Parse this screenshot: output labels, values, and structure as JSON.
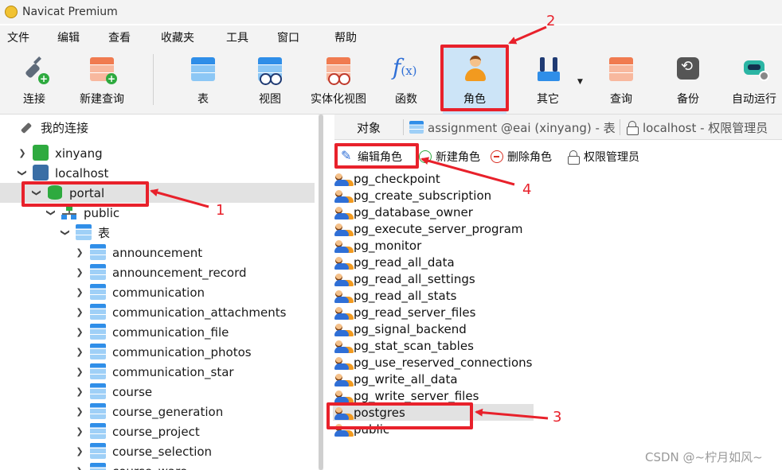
{
  "window": {
    "title": "Navicat Premium"
  },
  "menu": [
    "文件",
    "编辑",
    "查看",
    "收藏夹",
    "工具",
    "窗口",
    "帮助"
  ],
  "toolbar": {
    "connect": "连接",
    "new_query": "新建查询",
    "table": "表",
    "view": "视图",
    "materialized_view": "实体化视图",
    "function": "函数",
    "function_glyph": "f",
    "function_glyph_sub": "(x)",
    "role": "角色",
    "other": "其它",
    "query": "查询",
    "backup": "备份",
    "automation": "自动运行",
    "more_glyph": "▼"
  },
  "tree": {
    "root": "我的连接",
    "connections": [
      {
        "name": "xinyang",
        "icon": "pg-connection-green-icon"
      },
      {
        "name": "localhost",
        "icon": "pg-connection-elephant-icon"
      }
    ],
    "database": "portal",
    "schema": "public",
    "tables_folder": "表",
    "tables": [
      "announcement",
      "announcement_record",
      "communication",
      "communication_attachments",
      "communication_file",
      "communication_photos",
      "communication_star",
      "course",
      "course_generation",
      "course_project",
      "course_selection",
      "course_ware"
    ]
  },
  "tabs": {
    "objects": "对象",
    "assignment": "assignment @eai (xinyang) - 表",
    "permissions": "localhost - 权限管理员"
  },
  "object_toolbar": {
    "edit_role": "编辑角色",
    "new_role": "新建角色",
    "delete_role": "删除角色",
    "permission_manager": "权限管理员"
  },
  "roles": [
    "pg_checkpoint",
    "pg_create_subscription",
    "pg_database_owner",
    "pg_execute_server_program",
    "pg_monitor",
    "pg_read_all_data",
    "pg_read_all_settings",
    "pg_read_all_stats",
    "pg_read_server_files",
    "pg_signal_backend",
    "pg_stat_scan_tables",
    "pg_use_reserved_connections",
    "pg_write_all_data",
    "pg_write_server_files",
    "postgres",
    "public"
  ],
  "selected_role": "postgres",
  "annotations": {
    "n1": "1",
    "n2": "2",
    "n3": "3",
    "n4": "4"
  },
  "watermark": "CSDN @~柠月如风~",
  "colors": {
    "annotation": "#e8212b",
    "active_tool": "#cce4f7",
    "selection": "#e2e2e2"
  }
}
